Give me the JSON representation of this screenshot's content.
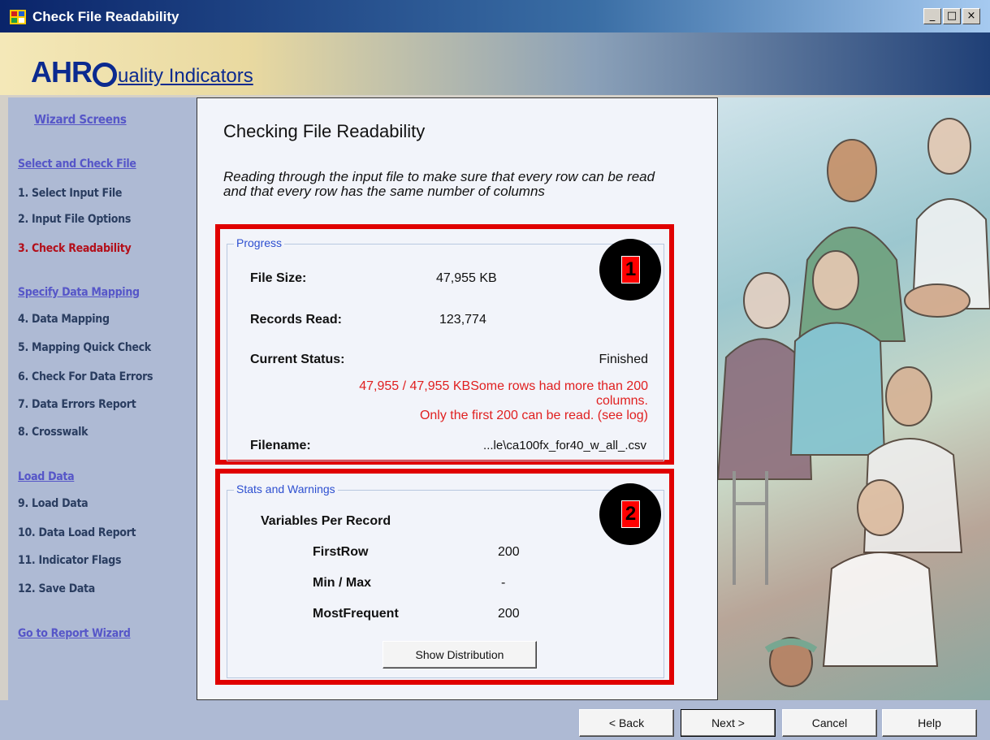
{
  "window": {
    "title": "Check File Readability"
  },
  "banner": {
    "logo_big": "AHR",
    "logo_small": "uality Indicators"
  },
  "sidebar": {
    "header": "Wizard Screens",
    "sections": [
      {
        "title": "Select and Check File",
        "items": [
          "1. Select Input File",
          "2. Input File Options",
          "3. Check Readability"
        ]
      },
      {
        "title": "Specify Data Mapping",
        "items": [
          "4. Data Mapping",
          "5. Mapping Quick Check",
          "6. Check For Data Errors",
          "7. Data Errors Report",
          "8. Crosswalk"
        ]
      },
      {
        "title": "Load Data",
        "items": [
          "9. Load Data",
          "10. Data Load Report",
          "11. Indicator Flags",
          "12. Save Data"
        ]
      }
    ],
    "footer_link": "Go to Report Wizard",
    "active_item": "3. Check Readability"
  },
  "main": {
    "title": "Checking File Readability",
    "description": "Reading through the input file to make sure that every row can be read and that every row has the same number of columns",
    "progress": {
      "legend": "Progress",
      "badge": "1",
      "file_size_label": "File Size:",
      "file_size_value": "47,955 KB",
      "records_read_label": "Records Read:",
      "records_read_value": "123,774",
      "current_status_label": "Current Status:",
      "current_status_value": "Finished",
      "warning_line1": "47,955 / 47,955 KBSome rows had more than 200",
      "warning_line2": "columns.",
      "warning_line3": "Only the first 200 can be read. (see log)",
      "filename_label": "Filename:",
      "filename_value": "...le\\ca100fx_for40_w_all_.csv"
    },
    "stats": {
      "legend": "Stats and Warnings",
      "badge": "2",
      "heading": "Variables Per Record",
      "first_row_label": "FirstRow",
      "first_row_value": "200",
      "minmax_label": "Min / Max",
      "minmax_value": "-",
      "most_frequent_label": "MostFrequent",
      "most_frequent_value": "200",
      "show_distribution": "Show Distribution"
    }
  },
  "footer": {
    "back": "< Back",
    "next": "Next >",
    "cancel": "Cancel",
    "help": "Help"
  },
  "colors": {
    "accent_red": "#e00000",
    "sidebar_bg": "#aebad4",
    "active_item": "#b30f1a",
    "link": "#5656c8"
  }
}
